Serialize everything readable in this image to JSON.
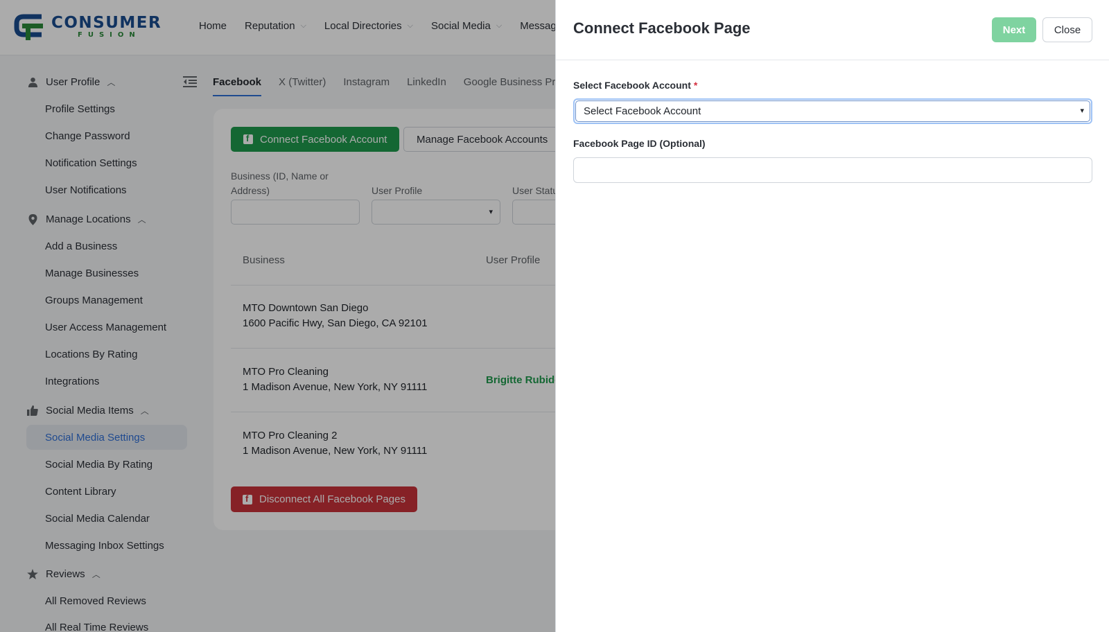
{
  "app": {
    "logo_primary": "CONSUMER",
    "logo_secondary": "FUSION"
  },
  "nav": [
    {
      "label": "Home",
      "has_menu": false
    },
    {
      "label": "Reputation",
      "has_menu": true
    },
    {
      "label": "Local Directories",
      "has_menu": true
    },
    {
      "label": "Social Media",
      "has_menu": true
    },
    {
      "label": "Messaging",
      "has_menu": false
    }
  ],
  "sidebar": {
    "sections": [
      {
        "label": "User Profile",
        "icon": "user-icon",
        "items": [
          "Profile Settings",
          "Change Password",
          "Notification Settings",
          "User Notifications"
        ]
      },
      {
        "label": "Manage Locations",
        "icon": "location-pin-icon",
        "items": [
          "Add a Business",
          "Manage Businesses",
          "Groups Management",
          "User Access Management",
          "Locations By Rating",
          "Integrations"
        ]
      },
      {
        "label": "Social Media Items",
        "icon": "thumbs-up-icon",
        "items": [
          "Social Media Settings",
          "Social Media By Rating",
          "Content Library",
          "Social Media Calendar",
          "Messaging Inbox Settings"
        ]
      },
      {
        "label": "Reviews",
        "icon": "star-icon",
        "items": [
          "All Removed Reviews",
          "All Real Time Reviews"
        ]
      }
    ],
    "active_item": "Social Media Settings"
  },
  "tabs": [
    "Facebook",
    "X (Twitter)",
    "Instagram",
    "LinkedIn",
    "Google Business Profile"
  ],
  "active_tab": "Facebook",
  "actions": {
    "connect_account": "Connect Facebook Account",
    "manage_accounts": "Manage Facebook Accounts",
    "disconnect_all": "Disconnect All Facebook Pages"
  },
  "filters": {
    "business_label": "Business (ID, Name or Address)",
    "user_profile_label": "User Profile",
    "user_status_label": "User Status"
  },
  "table": {
    "columns": [
      "Business",
      "User Profile"
    ],
    "rows": [
      {
        "name": "MTO Downtown San Diego",
        "address": "1600 Pacific Hwy, San Diego, CA 92101",
        "user": ""
      },
      {
        "name": "MTO Pro Cleaning",
        "address": "1 Madison Avenue, New York, NY 91111",
        "user": "Brigitte Rubidoux"
      },
      {
        "name": "MTO Pro Cleaning 2",
        "address": "1 Madison Avenue, New York, NY 91111",
        "user": ""
      }
    ]
  },
  "drawer": {
    "title": "Connect Facebook Page",
    "next_label": "Next",
    "close_label": "Close",
    "account_label": "Select Facebook Account",
    "account_required_mark": "*",
    "account_value": "Select Facebook Account",
    "page_id_label": "Facebook Page ID (Optional)",
    "page_id_value": ""
  },
  "colors": {
    "brand_blue": "#1a4d8f",
    "brand_green": "#2a8a3a",
    "primary_green": "#1f9a4c",
    "danger_red": "#c8323a",
    "next_disabled_green": "#7fd3a0",
    "active_blue": "#2f6fd6"
  }
}
